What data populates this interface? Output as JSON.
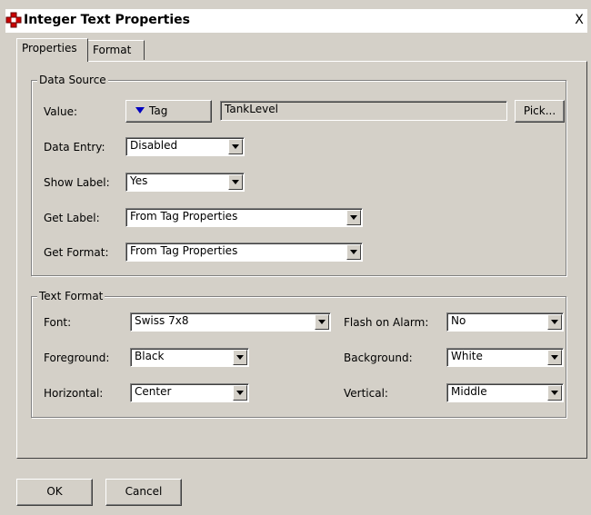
{
  "window": {
    "title": "Integer Text Properties",
    "close_label": "X"
  },
  "tabs": [
    {
      "label": "Properties"
    },
    {
      "label": "Format"
    }
  ],
  "data_source": {
    "group_label": "Data Source",
    "value_label": "Value:",
    "tag_button_label": "Tag",
    "value_field": "TankLevel",
    "pick_button_label": "Pick...",
    "data_entry_label": "Data Entry:",
    "data_entry_value": "Disabled",
    "show_label_label": "Show Label:",
    "show_label_value": "Yes",
    "get_label_label": "Get Label:",
    "get_label_value": "From Tag Properties",
    "get_format_label": "Get Format:",
    "get_format_value": "From Tag Properties"
  },
  "text_format": {
    "group_label": "Text Format",
    "font_label": "Font:",
    "font_value": "Swiss 7x8",
    "flash_label": "Flash on Alarm:",
    "flash_value": "No",
    "foreground_label": "Foreground:",
    "foreground_value": "Black",
    "background_label": "Background:",
    "background_value": "White",
    "horizontal_label": "Horizontal:",
    "horizontal_value": "Center",
    "vertical_label": "Vertical:",
    "vertical_value": "Middle"
  },
  "footer": {
    "ok_label": "OK",
    "cancel_label": "Cancel"
  },
  "colors": {
    "dialog_bg": "#d4d0c8",
    "tag_arrow": "#0000c0",
    "icon_red": "#cc0000"
  },
  "icons": {
    "app": "component-icon",
    "close": "close-icon"
  }
}
